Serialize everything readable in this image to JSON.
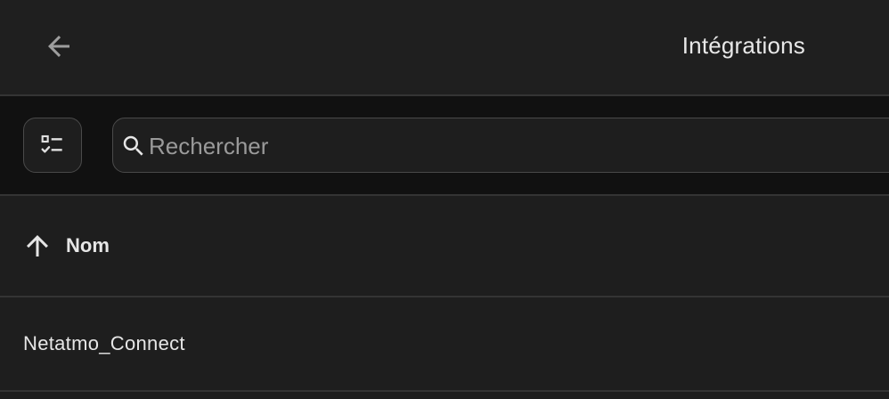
{
  "header": {
    "title": "Intégrations",
    "back_icon": "arrow-left-icon"
  },
  "toolbar": {
    "filter_icon": "filter-list-icon",
    "search": {
      "placeholder": "Rechercher",
      "value": "",
      "icon": "search-icon"
    }
  },
  "table": {
    "columns": [
      {
        "label": "Nom",
        "sort": "ascending",
        "icon": "arrow-up-icon"
      }
    ],
    "rows": [
      {
        "name": "Netatmo_Connect"
      }
    ]
  },
  "colors": {
    "background": "#1e1e1e",
    "toolbar_background": "#111111",
    "divider": "#343434",
    "text": "#e6e6e6",
    "muted": "#9a9a9a"
  }
}
